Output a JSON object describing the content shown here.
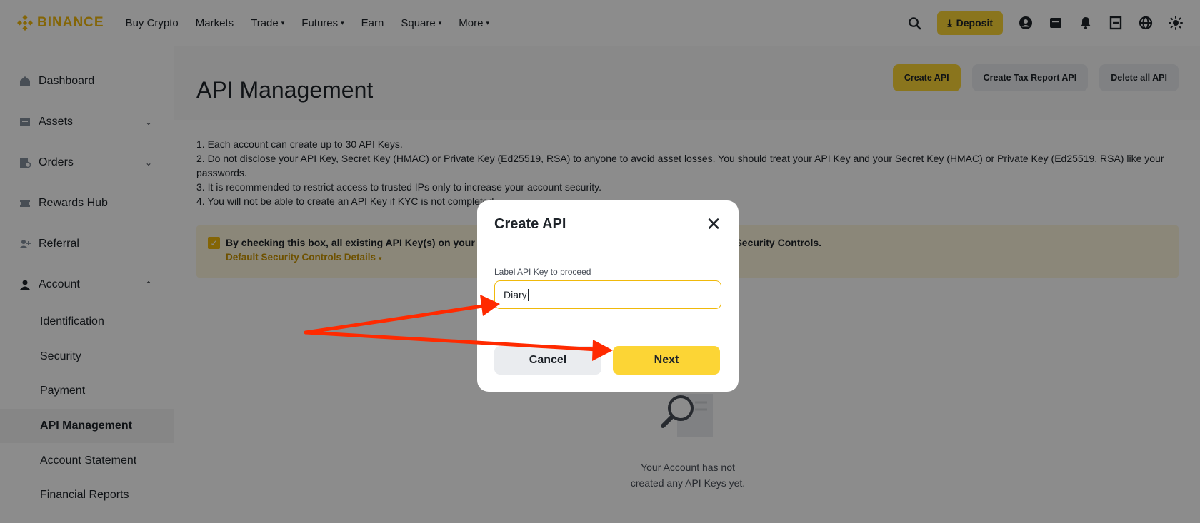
{
  "header": {
    "logo_text": "BINANCE",
    "nav": [
      {
        "label": "Buy Crypto",
        "caret": false
      },
      {
        "label": "Markets",
        "caret": false
      },
      {
        "label": "Trade",
        "caret": true
      },
      {
        "label": "Futures",
        "caret": true
      },
      {
        "label": "Earn",
        "caret": false
      },
      {
        "label": "Square",
        "caret": true
      },
      {
        "label": "More",
        "caret": true
      }
    ],
    "deposit_label": "Deposit",
    "icons": [
      "search-icon",
      "deposit-icon",
      "account-icon",
      "wallet-icon",
      "bell-icon",
      "download-icon",
      "globe-icon",
      "theme-icon"
    ]
  },
  "sidebar": {
    "items": [
      {
        "label": "Dashboard",
        "icon": "home-icon",
        "chevron": ""
      },
      {
        "label": "Assets",
        "icon": "wallet-icon",
        "chevron": "down"
      },
      {
        "label": "Orders",
        "icon": "orders-icon",
        "chevron": "down"
      },
      {
        "label": "Rewards Hub",
        "icon": "ticket-icon",
        "chevron": ""
      },
      {
        "label": "Referral",
        "icon": "add-user-icon",
        "chevron": ""
      },
      {
        "label": "Account",
        "icon": "user-icon",
        "chevron": "up"
      }
    ],
    "sub_items": [
      {
        "label": "Identification",
        "active": false
      },
      {
        "label": "Security",
        "active": false
      },
      {
        "label": "Payment",
        "active": false
      },
      {
        "label": "API Management",
        "active": true
      },
      {
        "label": "Account Statement",
        "active": false
      },
      {
        "label": "Financial Reports",
        "active": false
      }
    ]
  },
  "main": {
    "title": "API Management",
    "actions": {
      "create": "Create API",
      "tax": "Create Tax Report API",
      "delete": "Delete all API"
    },
    "notes": [
      "1. Each account can create up to 30 API Keys.",
      "2. Do not disclose your API Key, Secret Key (HMAC) or Private Key (Ed25519, RSA) to anyone to avoid asset losses. You should treat your API Key and your Secret Key (HMAC) or Private Key (Ed25519, RSA) like your passwords.",
      "3. It is recommended to restrict access to trusted IPs only to increase your account security.",
      "4. You will not be able to create an API Key if KYC is not completed."
    ],
    "warning": {
      "text_start": "By checking this box, all existing API Key(s) on your ma",
      "text_end": "t Security Controls.",
      "link": "Default Security Controls Details"
    },
    "empty_state": {
      "line1": "Your Account has not",
      "line2": "created any API Keys yet."
    }
  },
  "modal": {
    "title": "Create API",
    "field_label": "Label API Key to proceed",
    "field_value": "Diary",
    "cancel_label": "Cancel",
    "next_label": "Next"
  },
  "colors": {
    "brand": "#F0B90B",
    "button_yellow": "#FCD535",
    "annotation_arrow": "#FF2A00"
  }
}
